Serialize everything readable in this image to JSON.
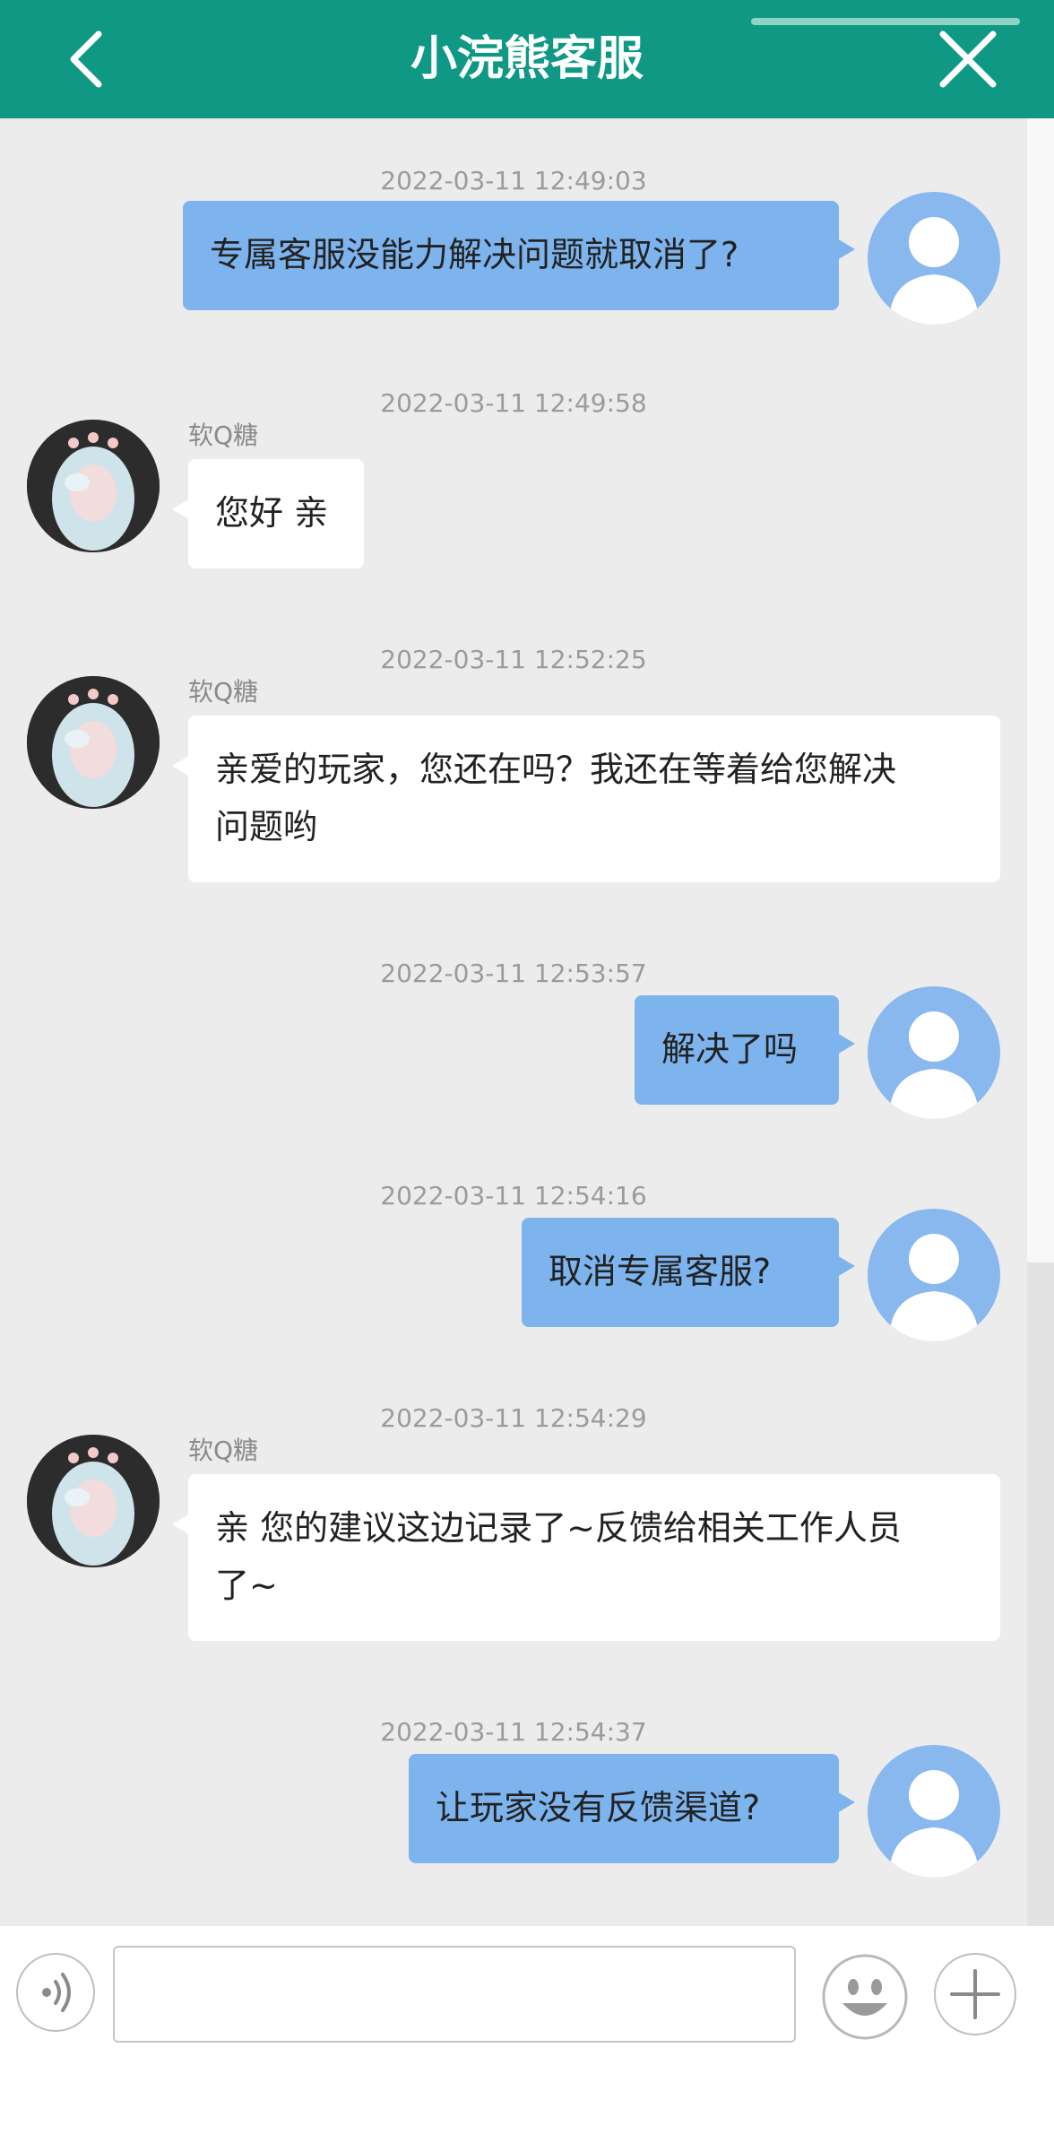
{
  "header": {
    "title": "小浣熊客服"
  },
  "agent_name": "软Q糖",
  "messages": [
    {
      "time": "2022-03-11 12:49:03",
      "text": "专属客服没能力解决问题就取消了?"
    },
    {
      "time": "2022-03-11 12:49:58",
      "name": "软Q糖",
      "text": "您好 亲"
    },
    {
      "time": "2022-03-11 12:52:25",
      "name": "软Q糖",
      "line1": "亲爱的玩家，您还在吗？我还在等着给您解决",
      "line2": "问题哟"
    },
    {
      "time": "2022-03-11 12:53:57",
      "text": "解决了吗"
    },
    {
      "time": "2022-03-11 12:54:16",
      "text": "取消专属客服?"
    },
    {
      "time": "2022-03-11 12:54:29",
      "name": "软Q糖",
      "line1": "亲 您的建议这边记录了~反馈给相关工作人员",
      "line2": "了~"
    },
    {
      "time": "2022-03-11 12:54:37",
      "text": "让玩家没有反馈渠道?"
    }
  ],
  "input": {
    "value": "",
    "placeholder": ""
  },
  "icons": {
    "back": "chevron-left-icon",
    "close": "close-icon",
    "voice": "voice-icon",
    "emoji": "emoji-icon",
    "plus": "plus-icon"
  },
  "colors": {
    "header": "#0f9884",
    "outgoing_bubble": "#7eb4ee",
    "incoming_bubble": "#ffffff",
    "chat_background": "#ececec"
  }
}
